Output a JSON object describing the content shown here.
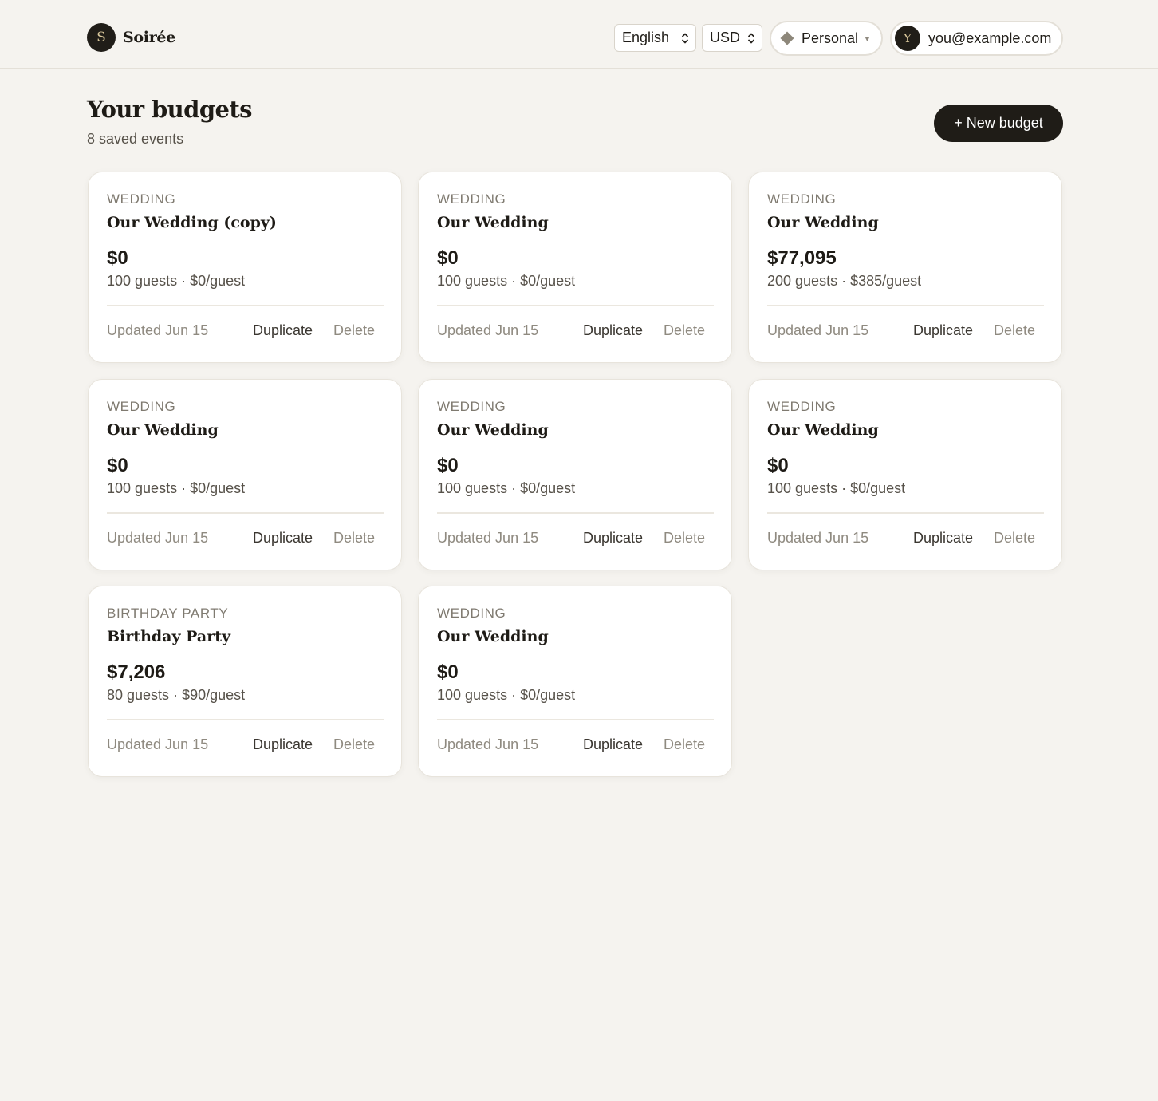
{
  "app": {
    "logo_letter": "S",
    "name": "Soirée"
  },
  "header": {
    "language": "English",
    "currency": "USD",
    "workspace": "Personal",
    "user_initial": "Y",
    "user_email": "you@example.com"
  },
  "page": {
    "title": "Your budgets",
    "subtitle": "8 saved events",
    "new_button": "+ New budget"
  },
  "actions": {
    "duplicate": "Duplicate",
    "delete": "Delete"
  },
  "budgets": [
    {
      "type": "Wedding",
      "title": "Our Wedding (copy)",
      "total": "$0",
      "meta": "100 guests · $0/guest",
      "updated": "Updated Jun 15"
    },
    {
      "type": "Wedding",
      "title": "Our Wedding",
      "total": "$0",
      "meta": "100 guests · $0/guest",
      "updated": "Updated Jun 15"
    },
    {
      "type": "Wedding",
      "title": "Our Wedding",
      "total": "$77,095",
      "meta": "200 guests · $385/guest",
      "updated": "Updated Jun 15"
    },
    {
      "type": "Wedding",
      "title": "Our Wedding",
      "total": "$0",
      "meta": "100 guests · $0/guest",
      "updated": "Updated Jun 15"
    },
    {
      "type": "Wedding",
      "title": "Our Wedding",
      "total": "$0",
      "meta": "100 guests · $0/guest",
      "updated": "Updated Jun 15"
    },
    {
      "type": "Wedding",
      "title": "Our Wedding",
      "total": "$0",
      "meta": "100 guests · $0/guest",
      "updated": "Updated Jun 15"
    },
    {
      "type": "Birthday Party",
      "title": "Birthday Party",
      "total": "$7,206",
      "meta": "80 guests · $90/guest",
      "updated": "Updated Jun 15"
    },
    {
      "type": "Wedding",
      "title": "Our Wedding",
      "total": "$0",
      "meta": "100 guests · $0/guest",
      "updated": "Updated Jun 15"
    }
  ],
  "colors": {
    "accent": "#1f1c17",
    "background": "#f5f3ef",
    "card": "#ffffff"
  }
}
